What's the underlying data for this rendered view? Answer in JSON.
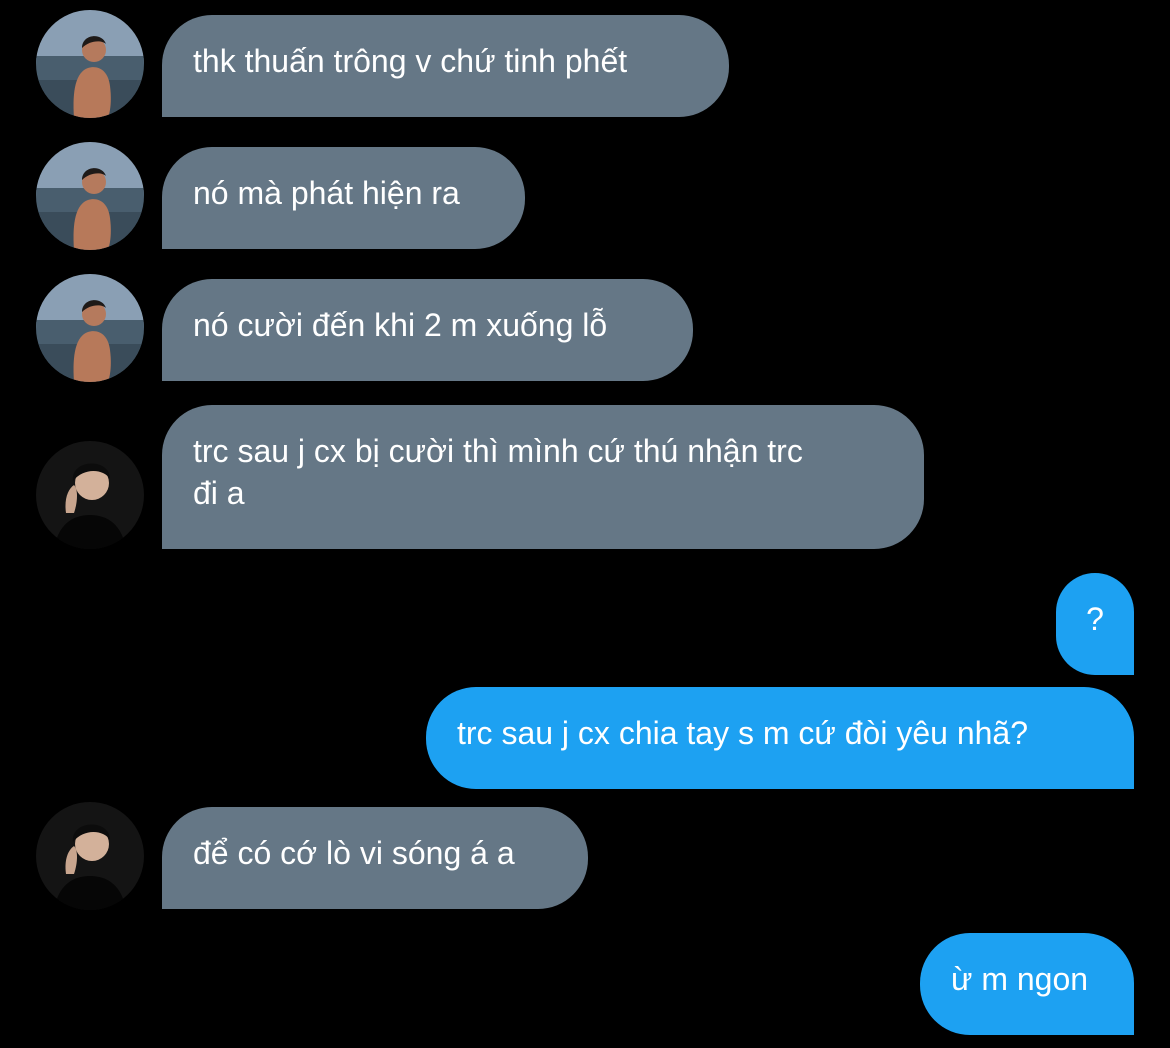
{
  "conversation": {
    "messages": [
      {
        "direction": "incoming",
        "sender_avatar": "person-beach-avatar",
        "text": "thk thuấn trông v chứ tinh phết"
      },
      {
        "direction": "incoming",
        "sender_avatar": "person-beach-avatar",
        "text": "nó mà phát hiện ra"
      },
      {
        "direction": "incoming",
        "sender_avatar": "person-beach-avatar",
        "text": "nó cười đến khi 2 m xuống lỗ"
      },
      {
        "direction": "incoming",
        "sender_avatar": "person-dark-avatar",
        "text": "trc sau j cx bị cười thì mình cứ thú nhận trc\nđi a"
      },
      {
        "direction": "outgoing",
        "text": "?"
      },
      {
        "direction": "outgoing",
        "text": "trc sau j cx chia tay s m cứ đòi yêu nhã?"
      },
      {
        "direction": "incoming",
        "sender_avatar": "person-dark-avatar",
        "text": "để có cớ lò vi sóng á a"
      },
      {
        "direction": "outgoing",
        "text": "ừ m ngon"
      }
    ]
  },
  "colors": {
    "background": "#000000",
    "incoming_bubble": "#657786",
    "outgoing_bubble": "#1da1f2",
    "message_text": "#ffffff"
  }
}
